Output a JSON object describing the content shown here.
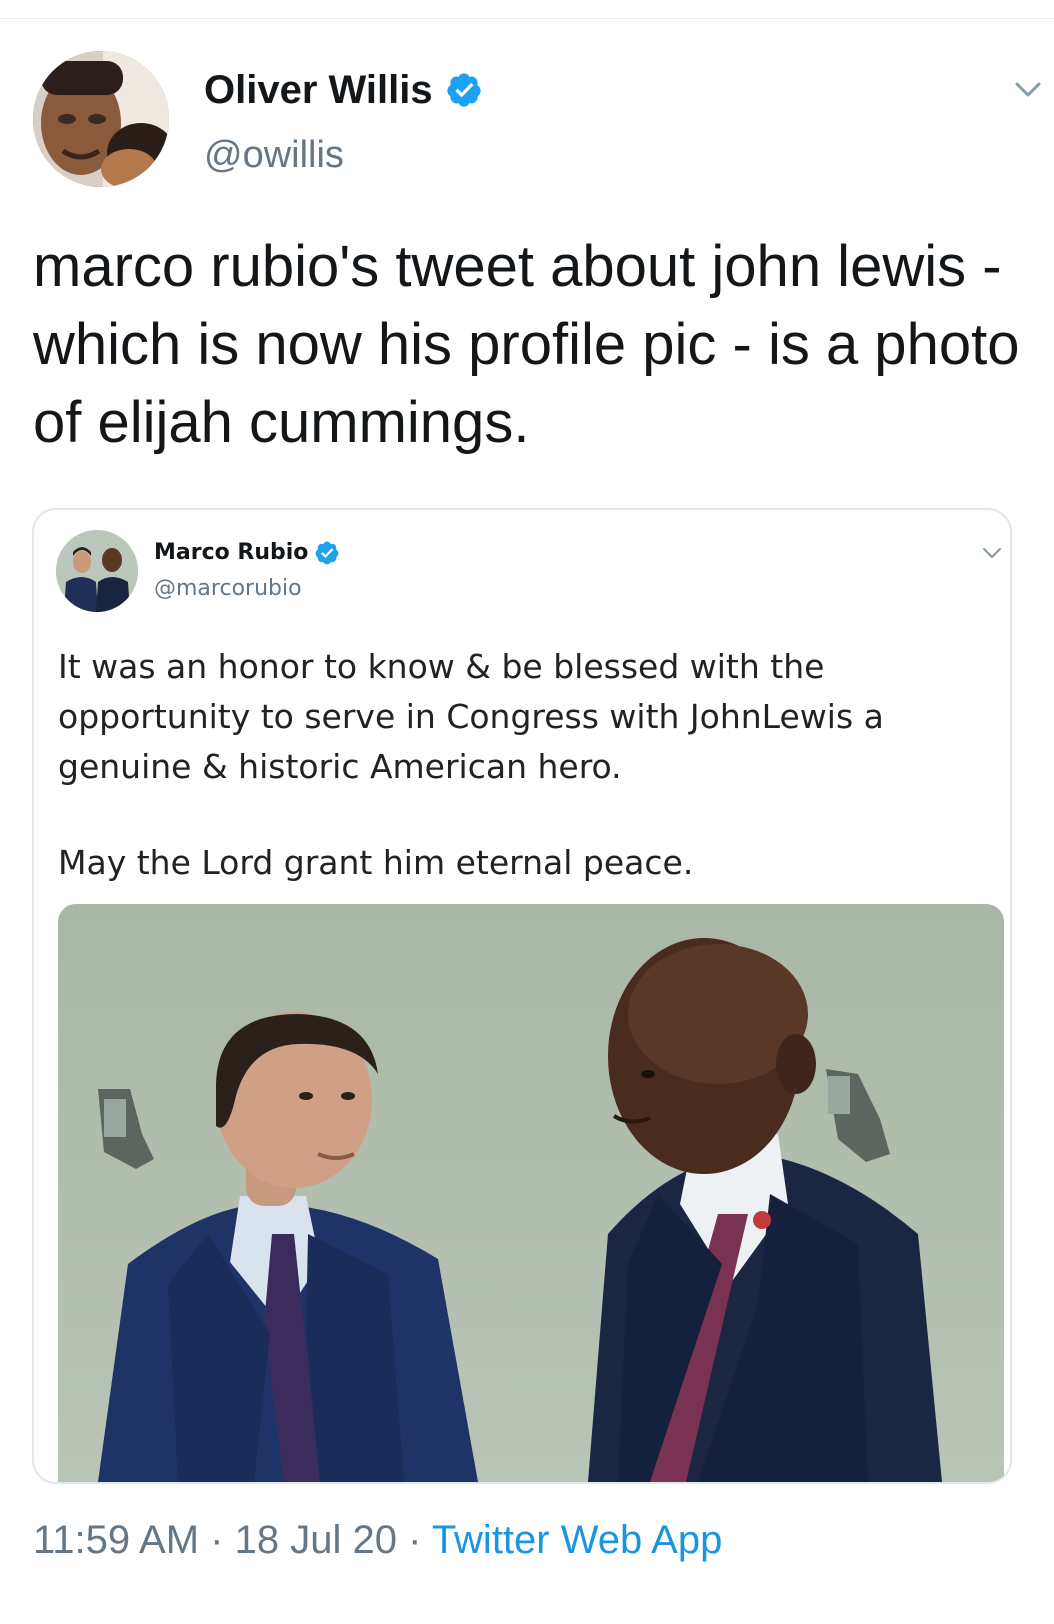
{
  "tweet": {
    "author_name": "Oliver Willis",
    "author_handle": "@owillis",
    "verified": true,
    "text": "marco rubio's tweet about john lewis - which is now his profile pic - is a photo of elijah cummings.",
    "time": "11:59 AM",
    "separator": "·",
    "date": "18 Jul 20",
    "source": "Twitter Web App"
  },
  "quoted_tweet": {
    "author_name": "Marco Rubio",
    "author_handle": "@marcorubio",
    "verified": true,
    "text_paragraph_1": "It was an honor to know & be blessed with the opportunity to serve in Congress with JohnLewis a genuine & historic American hero.",
    "text_paragraph_2": "May the Lord grant him eternal peace."
  },
  "colors": {
    "verified_blue": "#1da1f2",
    "link_blue": "#1b95e0",
    "secondary_text": "#657786",
    "border": "#e1e8ed"
  },
  "icons": {
    "verified": "verified-badge-icon",
    "menu": "chevron-down-icon"
  }
}
